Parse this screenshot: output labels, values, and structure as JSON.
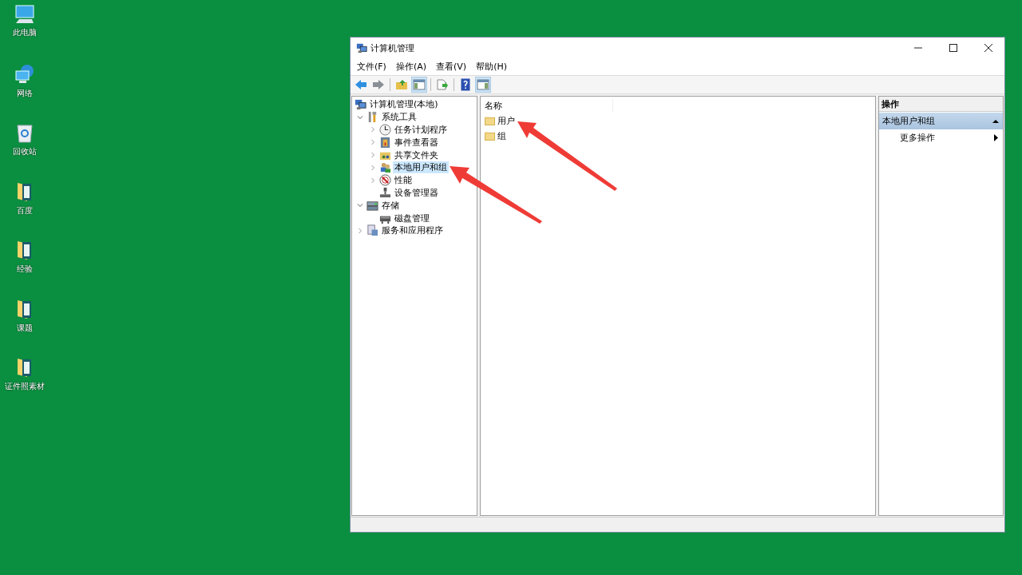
{
  "desktop_icons": [
    {
      "label": "此电脑",
      "kind": "computer"
    },
    {
      "label": "网络",
      "kind": "network"
    },
    {
      "label": "回收站",
      "kind": "recycle-bin"
    },
    {
      "label": "百度",
      "kind": "folder"
    },
    {
      "label": "经验",
      "kind": "folder"
    },
    {
      "label": "课题",
      "kind": "folder"
    },
    {
      "label": "证件照素材",
      "kind": "folder"
    }
  ],
  "window": {
    "title": "计算机管理",
    "menu": [
      "文件(F)",
      "操作(A)",
      "查看(V)",
      "帮助(H)"
    ],
    "toolbar": [
      {
        "kind": "back",
        "pressed": false
      },
      {
        "kind": "forward",
        "pressed": false
      },
      {
        "kind": "up-folder",
        "pressed": false
      },
      {
        "kind": "console-tree",
        "pressed": true
      },
      {
        "kind": "export",
        "pressed": false
      },
      {
        "kind": "help",
        "pressed": false
      },
      {
        "kind": "action-pane",
        "pressed": true
      }
    ],
    "tree": [
      {
        "label": "计算机管理(本地)",
        "selected": false,
        "children": [
          {
            "label": "系统工具",
            "selected": false,
            "expanded": true,
            "children": [
              {
                "label": "任务计划程序",
                "selected": false,
                "expanded": false
              },
              {
                "label": "事件查看器",
                "selected": false,
                "expanded": false
              },
              {
                "label": "共享文件夹",
                "selected": false,
                "expanded": false
              },
              {
                "label": "本地用户和组",
                "selected": true,
                "expanded": false
              },
              {
                "label": "性能",
                "selected": false,
                "expanded": false
              },
              {
                "label": "设备管理器",
                "selected": false
              }
            ]
          },
          {
            "label": "存储",
            "selected": false,
            "expanded": true,
            "children": [
              {
                "label": "磁盘管理",
                "selected": false
              }
            ]
          },
          {
            "label": "服务和应用程序",
            "selected": false,
            "expanded": false
          }
        ]
      }
    ],
    "list": {
      "column": "名称",
      "items": [
        "用户",
        "组"
      ]
    },
    "actions": {
      "title": "操作",
      "section": {
        "label": "本地用户和组",
        "expanded": true
      },
      "items": [
        {
          "label": "更多操作",
          "submenu": true
        }
      ]
    }
  }
}
